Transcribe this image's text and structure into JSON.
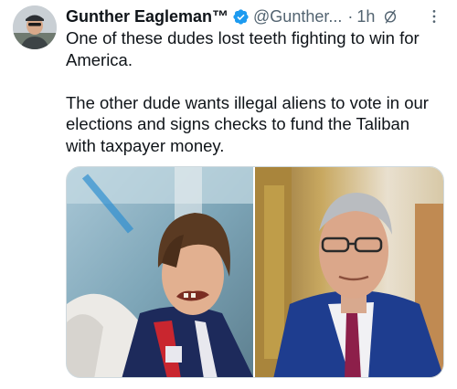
{
  "post": {
    "display_name": "Gunther Eagleman™",
    "handle": "@Gunther...",
    "separator": "·",
    "time": "1h",
    "text_paragraphs": [
      "One of these dudes lost teeth fighting to win for America.",
      "The other dude wants illegal aliens to vote in our elections and signs checks to fund the Taliban with taxpayer money."
    ]
  },
  "icons": {
    "verified": "verified-badge-icon",
    "grok": "grok-slash-icon",
    "more": "more-dots-icon"
  },
  "colors": {
    "text": "#0f1419",
    "secondary": "#536471",
    "verified_blue": "#1d9bf0",
    "border": "#cfd9de"
  }
}
